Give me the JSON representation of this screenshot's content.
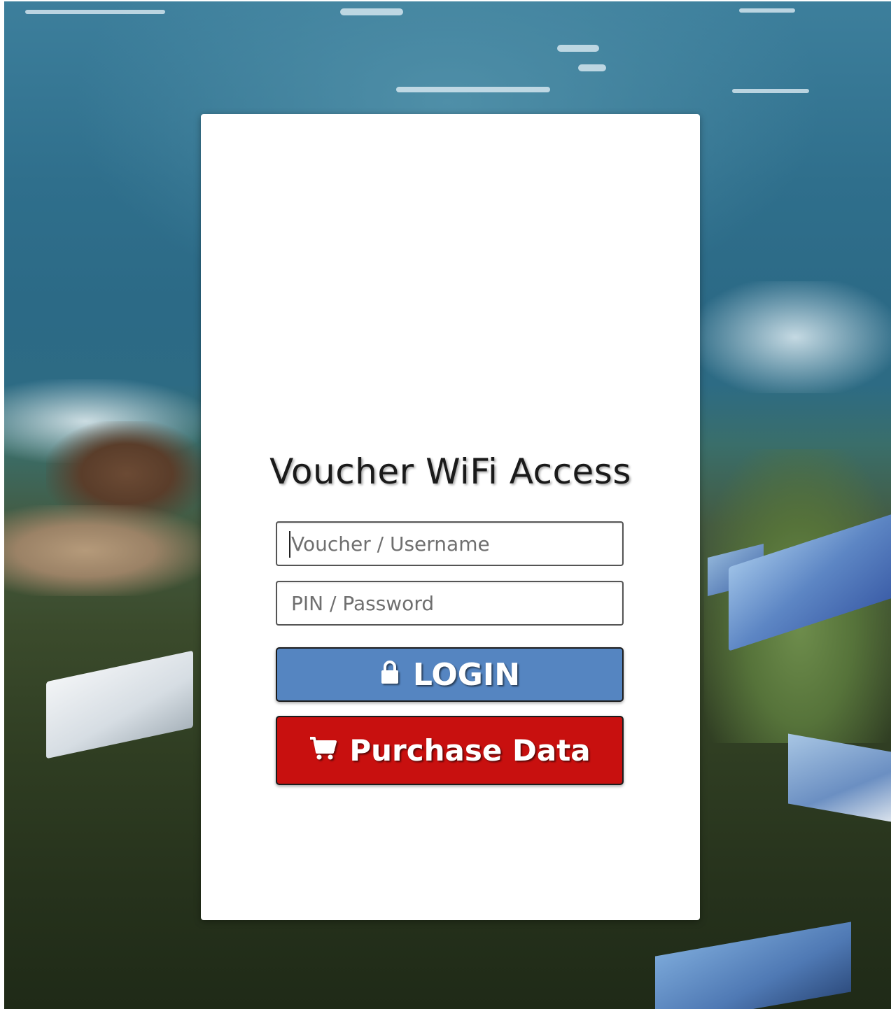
{
  "title": "Voucher WiFi Access",
  "form": {
    "username_placeholder": "Voucher / Username",
    "username_value": "",
    "password_placeholder": "PIN / Password",
    "password_value": "",
    "login_label": "LOGIN",
    "purchase_label": "Purchase Data"
  },
  "icons": {
    "login": "lock-icon",
    "purchase": "cart-icon"
  },
  "colors": {
    "login_button": "#5585c1",
    "purchase_button": "#c8100f",
    "card_background": "#ffffff"
  }
}
